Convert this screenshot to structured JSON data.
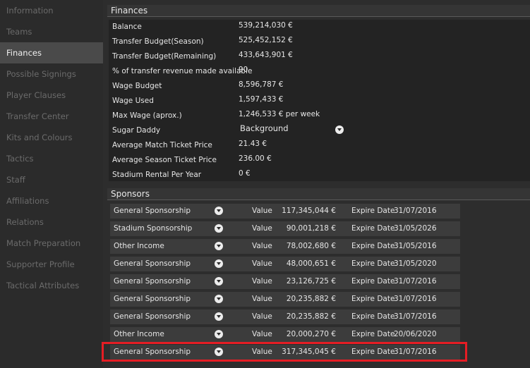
{
  "sidebar": {
    "items": [
      {
        "label": "Information"
      },
      {
        "label": "Teams"
      },
      {
        "label": "Finances"
      },
      {
        "label": "Possible Signings"
      },
      {
        "label": "Player Clauses"
      },
      {
        "label": "Transfer Center"
      },
      {
        "label": "Kits and Colours"
      },
      {
        "label": "Tactics"
      },
      {
        "label": "Staff"
      },
      {
        "label": "Affiliations"
      },
      {
        "label": "Relations"
      },
      {
        "label": "Match Preparation"
      },
      {
        "label": "Supporter Profile"
      },
      {
        "label": "Tactical Attributes"
      }
    ],
    "active": "Finances"
  },
  "finances": {
    "title": "Finances",
    "rows": [
      {
        "label": "Balance",
        "value": "539,214,030 €"
      },
      {
        "label": "Transfer Budget(Season)",
        "value": "525,452,152 €"
      },
      {
        "label": "Transfer Budget(Remaining)",
        "value": "433,643,901 €"
      },
      {
        "label": "% of transfer revenue made available",
        "value": "90"
      },
      {
        "label": "Wage Budget",
        "value": "8,596,787 €"
      },
      {
        "label": "Wage Used",
        "value": "1,597,433 €"
      },
      {
        "label": "Max Wage (aprox.)",
        "value": "1,246,533 € per week"
      },
      {
        "label": "Sugar Daddy",
        "value": "Background",
        "type": "select"
      },
      {
        "label": "Average Match Ticket Price",
        "value": "21.43 €"
      },
      {
        "label": "Average Season Ticket Price",
        "value": "236.00 €"
      },
      {
        "label": "Stadium Rental Per Year",
        "value": "0 €"
      }
    ]
  },
  "sponsors": {
    "title": "Sponsors",
    "value_label": "Value",
    "expire_label": "Expire Date",
    "rows": [
      {
        "name": "General Sponsorship",
        "value": "117,345,044 €",
        "expire": "31/07/2016"
      },
      {
        "name": "Stadium Sponsorship",
        "value": "90,001,218 €",
        "expire": "31/05/2026"
      },
      {
        "name": "Other Income",
        "value": "78,002,680 €",
        "expire": "31/05/2016"
      },
      {
        "name": "General Sponsorship",
        "value": "48,000,651 €",
        "expire": "31/05/2020"
      },
      {
        "name": "General Sponsorship",
        "value": "23,126,725 €",
        "expire": "31/07/2016"
      },
      {
        "name": "General Sponsorship",
        "value": "20,235,882 €",
        "expire": "31/07/2016"
      },
      {
        "name": "General Sponsorship",
        "value": "20,235,882 €",
        "expire": "31/07/2016"
      },
      {
        "name": "Other Income",
        "value": "20,000,270 €",
        "expire": "20/06/2020"
      },
      {
        "name": "General Sponsorship",
        "value": "317,345,045 €",
        "expire": "31/07/2016"
      }
    ]
  },
  "colors": {
    "background": "#2d2d2d",
    "panel": "#232323",
    "row": "#3c3c3c",
    "active_nav": "#4a4a4a",
    "inactive_nav_text": "#6b6b6b",
    "highlight": "#e51d24"
  },
  "icons": {
    "dropdown": "chevron-down-circle-icon"
  }
}
